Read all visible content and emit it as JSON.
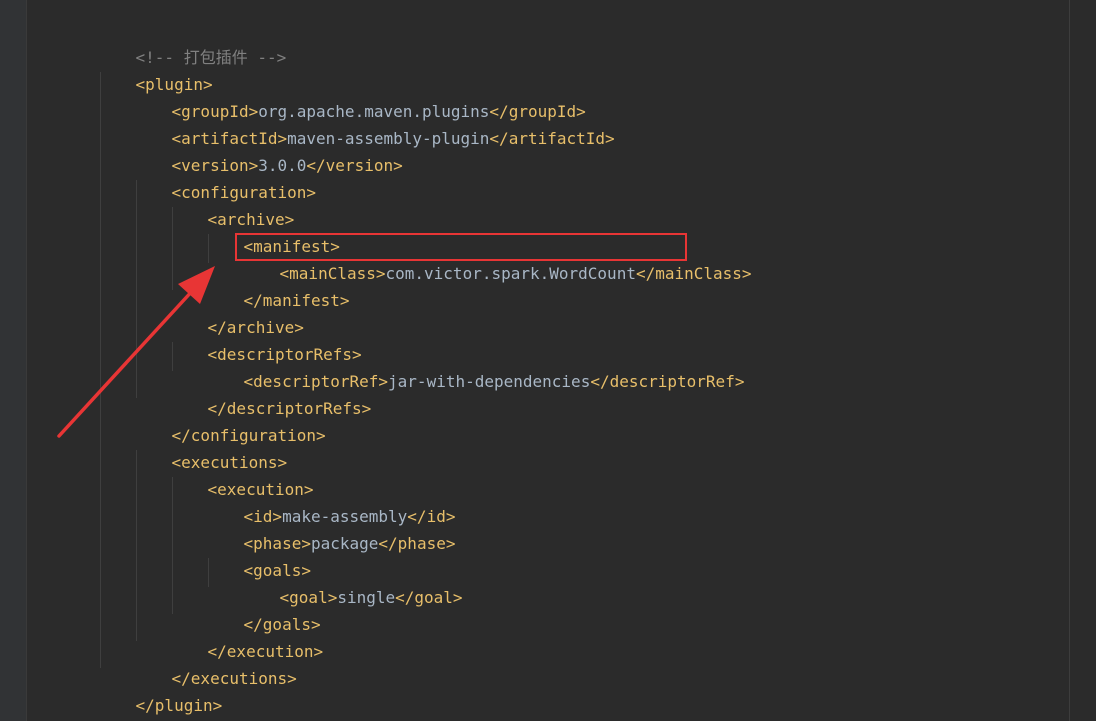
{
  "lines": [
    {
      "type": "comment",
      "text": "<!-- 打包插件 -->"
    },
    {
      "type": "tag",
      "open": "<plugin>"
    },
    {
      "type": "elem",
      "open": "<groupId>",
      "value": "org.apache.maven.plugins",
      "close": "</groupId>"
    },
    {
      "type": "elem",
      "open": "<artifactId>",
      "value": "maven-assembly-plugin",
      "close": "</artifactId>"
    },
    {
      "type": "elem",
      "open": "<version>",
      "value": "3.0.0",
      "close": "</version>"
    },
    {
      "type": "tag",
      "open": "<configuration>"
    },
    {
      "type": "tag",
      "open": "<archive>"
    },
    {
      "type": "tag",
      "open": "<manifest>"
    },
    {
      "type": "elem",
      "open": "<mainClass>",
      "value": "com.victor.spark.WordCount",
      "close": "</mainClass>"
    },
    {
      "type": "tag",
      "open": "</manifest>"
    },
    {
      "type": "tag",
      "open": "</archive>"
    },
    {
      "type": "tag",
      "open": "<descriptorRefs>"
    },
    {
      "type": "elem",
      "open": "<descriptorRef>",
      "value": "jar-with-dependencies",
      "close": "</descriptorRef>"
    },
    {
      "type": "tag",
      "open": "</descriptorRefs>"
    },
    {
      "type": "tag",
      "open": "</configuration>"
    },
    {
      "type": "tag",
      "open": "<executions>"
    },
    {
      "type": "tag",
      "open": "<execution>"
    },
    {
      "type": "elem",
      "open": "<id>",
      "value": "make-assembly",
      "close": "</id>"
    },
    {
      "type": "elem",
      "open": "<phase>",
      "value": "package",
      "close": "</phase>"
    },
    {
      "type": "tag",
      "open": "<goals>"
    },
    {
      "type": "elem",
      "open": "<goal>",
      "value": "single",
      "close": "</goal>"
    },
    {
      "type": "tag",
      "open": "</goals>"
    },
    {
      "type": "tag",
      "open": "</execution>"
    },
    {
      "type": "tag",
      "open": "</executions>"
    },
    {
      "type": "tag",
      "open": "</plugin>"
    }
  ],
  "annotation": {
    "highlight_color": "#e83535",
    "arrow_color": "#e83535",
    "highlighted_line": 9
  },
  "colors": {
    "background": "#2b2b2b",
    "tag": "#e8bf6a",
    "text": "#a9b7c6",
    "comment": "#808080"
  }
}
